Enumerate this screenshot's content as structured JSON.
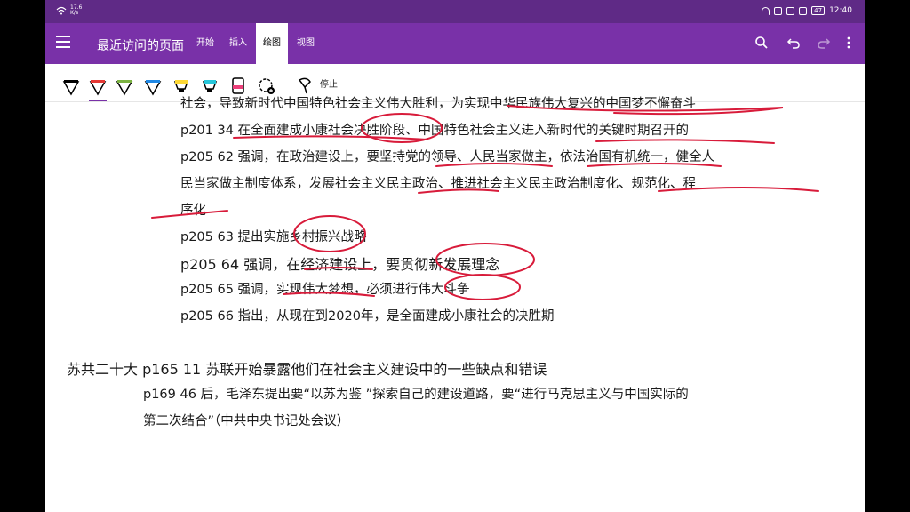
{
  "status_bar": {
    "network_speed": "17.6\nK/s",
    "battery": "47",
    "time": "12:40"
  },
  "toolbar": {
    "page_title": "最近访问的页面",
    "tabs": [
      {
        "label": "开始",
        "active": false
      },
      {
        "label": "插入",
        "active": false
      },
      {
        "label": "绘图",
        "active": true
      },
      {
        "label": "视图",
        "active": false
      }
    ],
    "accent_color": "#7931a8"
  },
  "ribbon": {
    "pens": [
      {
        "color": "#000000"
      },
      {
        "color": "#e53935"
      },
      {
        "color": "#7cb342"
      },
      {
        "color": "#1e88e5"
      },
      {
        "color": "#fdd835"
      },
      {
        "color": "#26c6da"
      },
      {
        "color": "#ec407a"
      }
    ],
    "stop_label": "停止"
  },
  "note": {
    "lines": [
      "社会，导致新时代中国特色社会主义伟大胜利，为实现中华民族伟大复兴的中国梦不懈奋斗",
      "p201 34 在全面建成小康社会决胜阶段、中国特色社会主义进入新时代的关键时期召开的",
      "p205 62 强调，在政治建设上，要坚持党的领导、人民当家做主，依法治国有机统一，健全人",
      "民当家做主制度体系，发展社会主义民主政治、推进社会主义民主政治制度化、规范化、程",
      "序化",
      "p205 63 提出实施乡村振兴战略",
      "p205 64 强调，在经济建设上，要贯彻新发展理念",
      "p205  65 强调，实现伟大梦想，必须进行伟大斗争",
      "p205 66 指出，从现在到2020年，是全面建成小康社会的决胜期",
      "苏共二十大 p165 11 苏联开始暴露他们在社会主义建设中的一些缺点和错误",
      "p169 46 后，毛泽东提出要“以苏为鉴 ”探索自己的建设道路，要“进行马克思主义与中国实际的",
      "第二次结合”（中共中央书记处会议）"
    ],
    "ink_color": "#d81b3a"
  }
}
